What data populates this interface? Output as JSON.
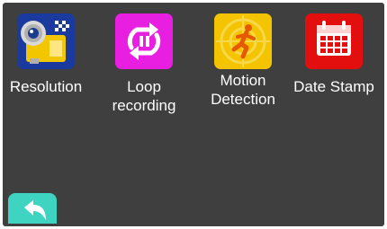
{
  "menu": {
    "items": [
      {
        "label": "Resolution",
        "icon": "camcorder-icon",
        "color": "#1a3a9e"
      },
      {
        "label": "Loop\nrecording",
        "icon": "loop-icon",
        "color": "#e81fe0"
      },
      {
        "label": "Motion\nDetection",
        "icon": "running-man-icon",
        "color": "#f4c400"
      },
      {
        "label": "Date Stamp",
        "icon": "calendar-icon",
        "color": "#e30e0e"
      }
    ]
  },
  "back": {
    "icon": "back-arrow-icon",
    "color": "#3fd4c1"
  }
}
